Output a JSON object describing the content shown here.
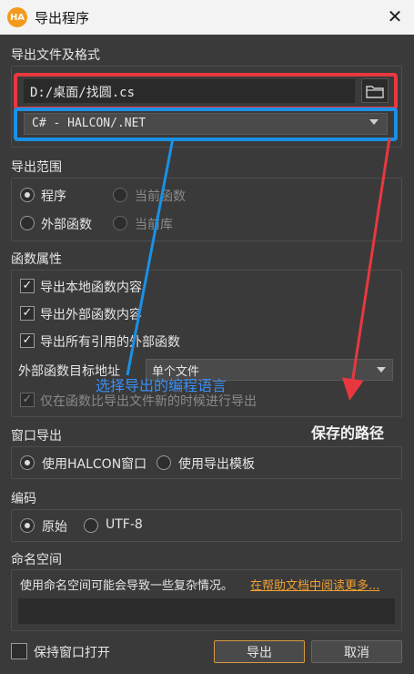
{
  "window": {
    "logo_text": "HA",
    "title": "导出程序",
    "close_glyph": "✕"
  },
  "file_format": {
    "section_title": "导出文件及格式",
    "path_value": "D:/桌面/找圆.cs",
    "format_value": "C# - HALCON/.NET"
  },
  "export_scope": {
    "section_title": "导出范围",
    "options": [
      {
        "label": "程序",
        "checked": true,
        "enabled": true
      },
      {
        "label": "当前函数",
        "checked": false,
        "enabled": false
      },
      {
        "label": "外部函数",
        "checked": false,
        "enabled": true
      },
      {
        "label": "当前库",
        "checked": false,
        "enabled": false
      }
    ]
  },
  "func_props": {
    "section_title": "函数属性",
    "checks": [
      {
        "label": "导出本地函数内容",
        "checked": true,
        "enabled": true
      },
      {
        "label": "导出外部函数内容",
        "checked": true,
        "enabled": true
      },
      {
        "label": "导出所有引用的外部函数",
        "checked": true,
        "enabled": true
      }
    ],
    "target_label": "外部函数目标地址",
    "target_value": "单个文件",
    "newer_only": {
      "label": "仅在函数比导出文件新的时候进行导出",
      "checked": true,
      "enabled": false
    }
  },
  "window_export": {
    "section_title": "窗口导出",
    "options": [
      {
        "label": "使用HALCON窗口",
        "checked": true
      },
      {
        "label": "使用导出模板",
        "checked": false
      }
    ]
  },
  "encoding": {
    "section_title": "编码",
    "options": [
      {
        "label": "原始",
        "checked": true
      },
      {
        "label": "UTF-8",
        "checked": false
      }
    ]
  },
  "namespace": {
    "section_title": "命名空间",
    "info": "使用命名空间可能会导致一些复杂情况。",
    "link": "在帮助文档中阅读更多..."
  },
  "footer": {
    "keep_open_label": "保持窗口打开",
    "export_label": "导出",
    "cancel_label": "取消"
  },
  "annotations": {
    "blue_text": "选择导出的编程语言",
    "red_text": "保存的路径",
    "blue_color": "#1a91e6",
    "red_color": "#e8383f"
  }
}
